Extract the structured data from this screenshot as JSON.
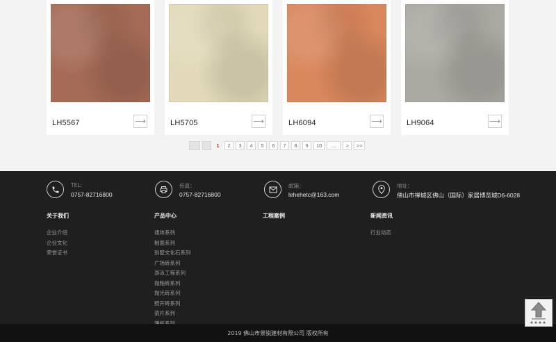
{
  "products": [
    {
      "code": "LH5567",
      "color": "#a56b57"
    },
    {
      "code": "LH5705",
      "color": "#e1d9b8"
    },
    {
      "code": "LH6094",
      "color": "#d9875c"
    },
    {
      "code": "LH9064",
      "color": "#a9a8a1"
    }
  ],
  "arrow_glyph": "⟶",
  "pagination": {
    "first": "",
    "prev": "",
    "pages": [
      "1",
      "2",
      "3",
      "4",
      "5",
      "6",
      "7",
      "8",
      "9",
      "10"
    ],
    "current": "1",
    "ellipsis": "...",
    "next": ">",
    "last": ">>"
  },
  "footer": {
    "contacts": [
      {
        "label": "TEL:",
        "value": "0757-82716800",
        "icon": "phone-icon"
      },
      {
        "label": "传真：",
        "value": "0757-82716800",
        "icon": "fax-icon"
      },
      {
        "label": "邮箱：",
        "value": "lehehetc@163.com",
        "icon": "mail-icon"
      },
      {
        "label": "地址：",
        "value": "佛山市禅城区佛山（国际）家居博览城D6-6028",
        "icon": "location-icon"
      }
    ],
    "columns": [
      {
        "title": "关于我们",
        "items": [
          "企业介绍",
          "企业文化",
          "荣誉证书"
        ]
      },
      {
        "title": "产品中心",
        "items": [
          "通体系列",
          "釉面系列",
          "别墅文化石系列",
          "广场砖系列",
          "游泳工程系列",
          "抛釉砖系列",
          "抛光砖系列",
          "劈开砖系列",
          "瓷片系列",
          "薄板系列"
        ]
      },
      {
        "title": "工程案例",
        "items": []
      },
      {
        "title": "新闻资讯",
        "items": [
          "行业动态"
        ]
      }
    ],
    "copyright": "2019 佛山市景锐建材有限公司 版权所有"
  },
  "colors": {
    "footer_bg": "#1f1f1f",
    "page_bg": "#f3f3f3",
    "current_page": "#d21d1d"
  }
}
